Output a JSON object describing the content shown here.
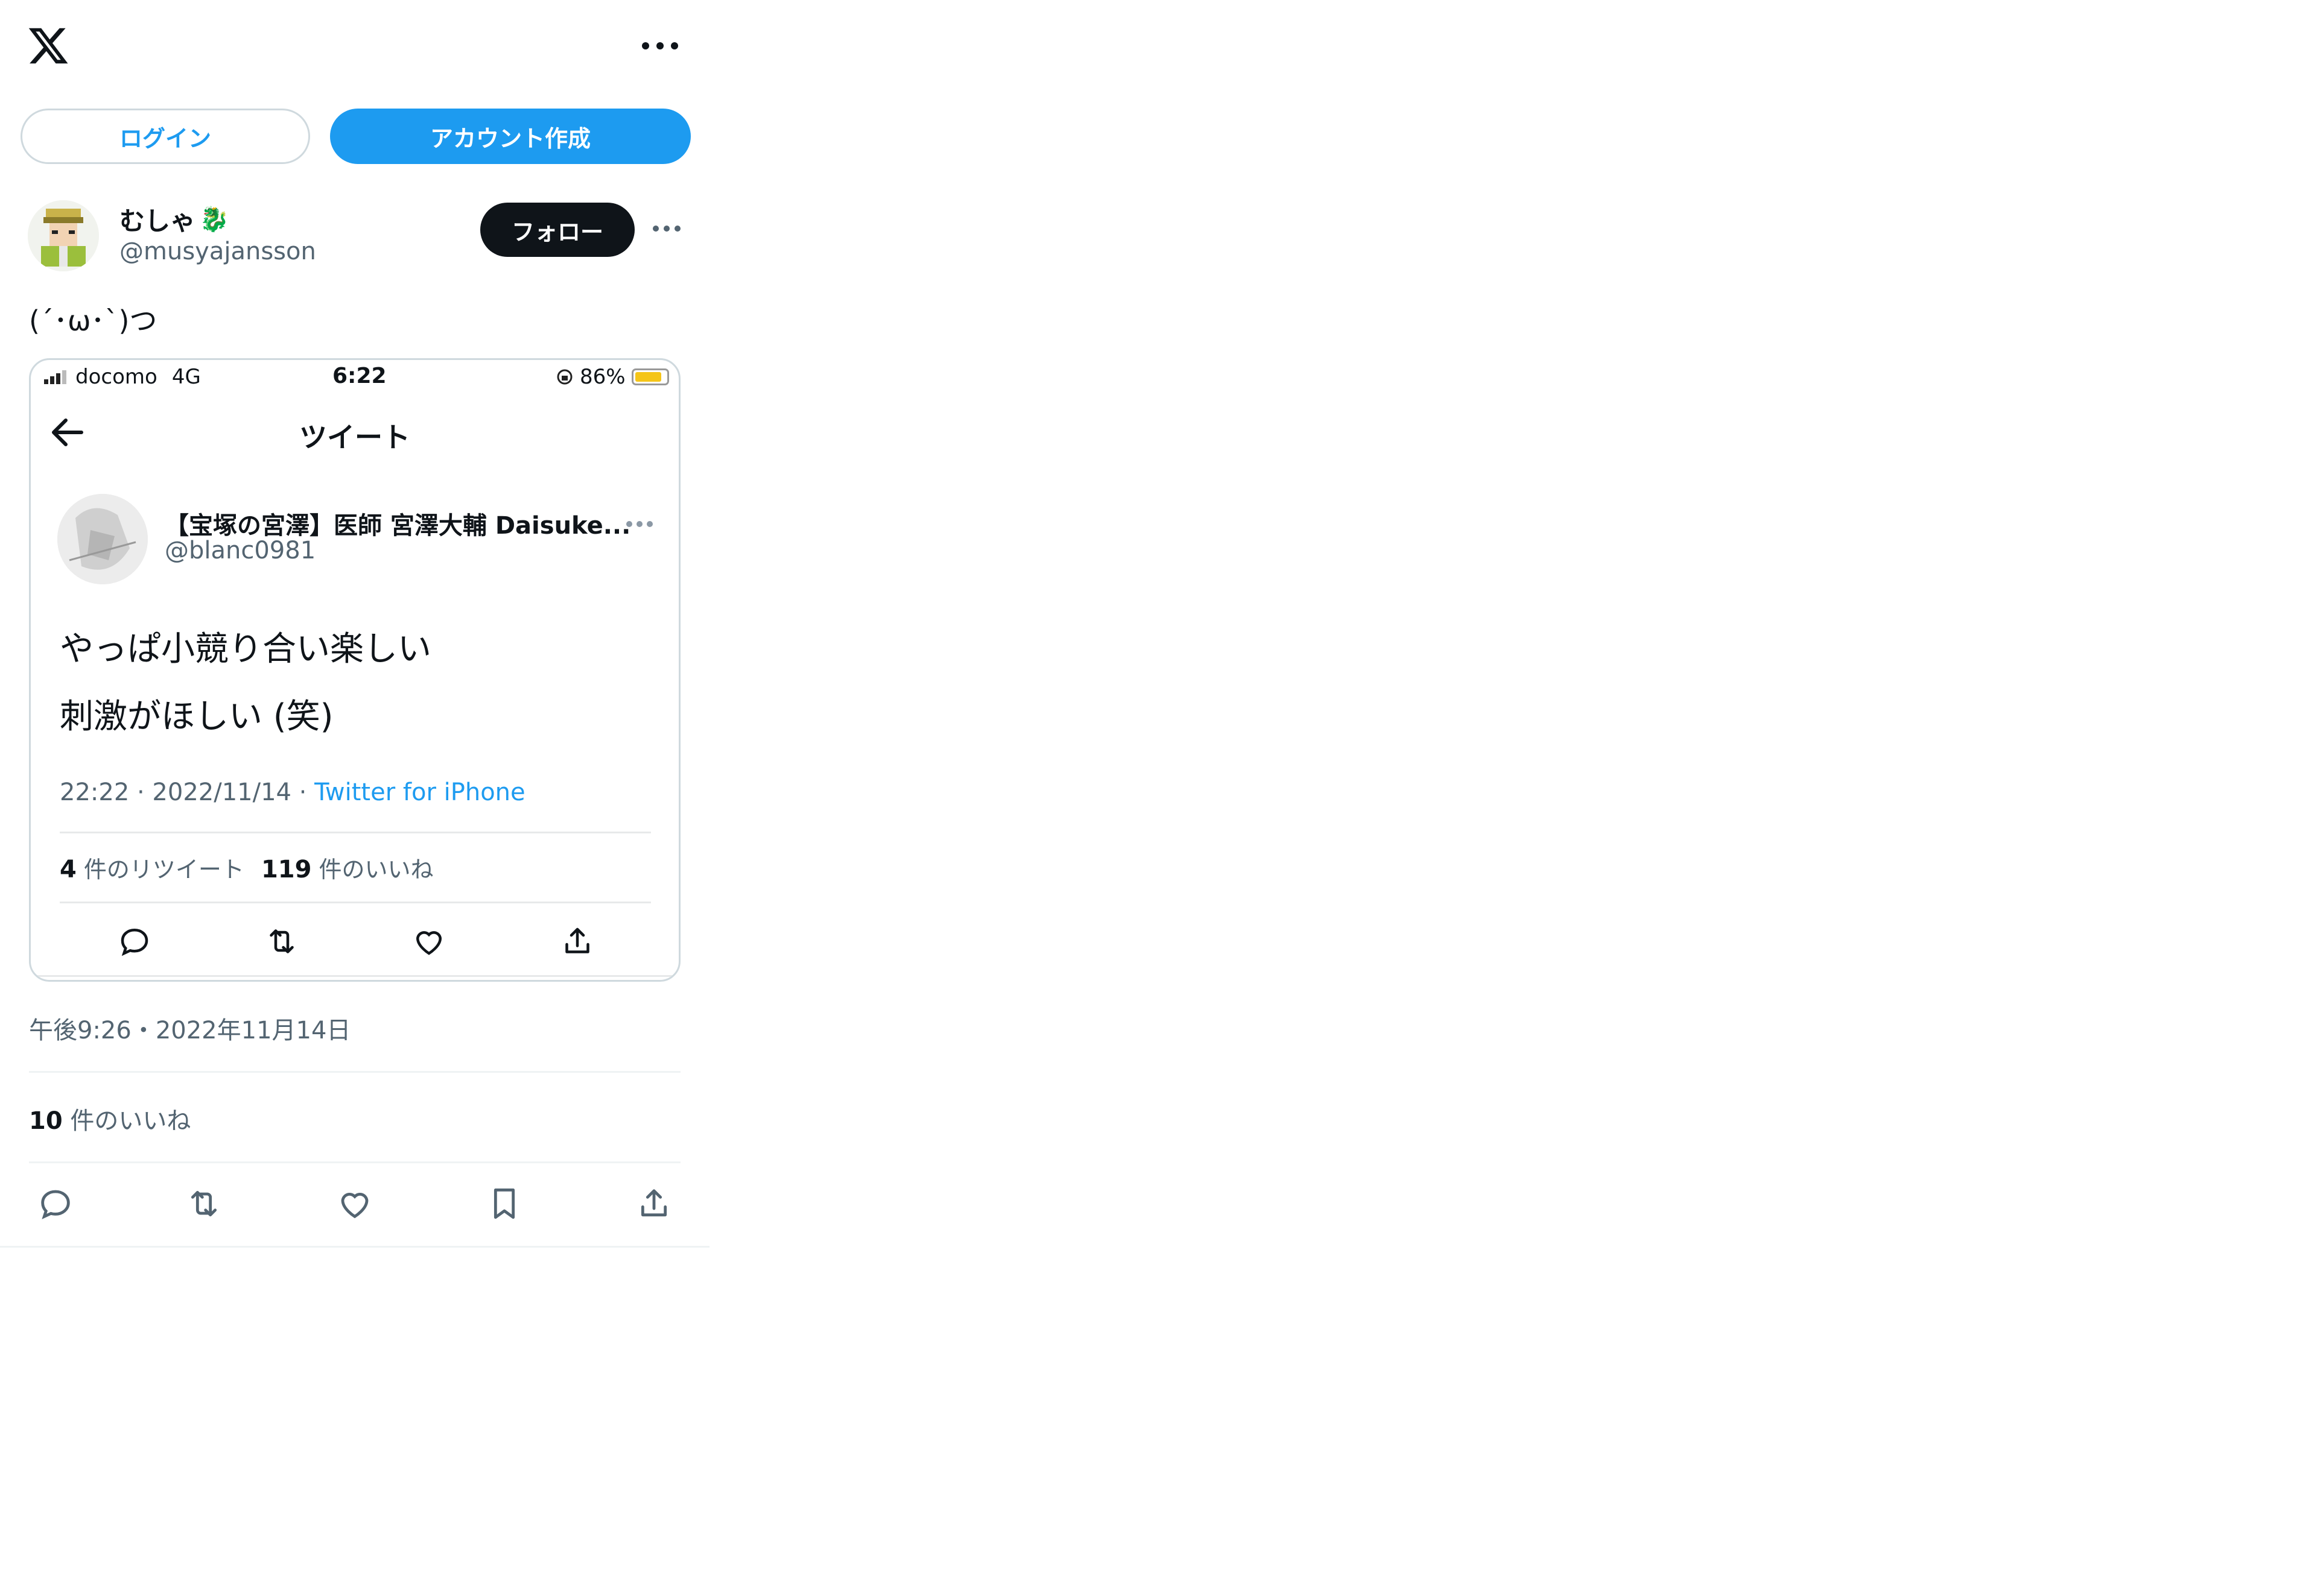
{
  "header": {
    "logo_icon": "x-logo-icon",
    "more_icon": "more-horizontal-icon"
  },
  "auth": {
    "login_label": "ログイン",
    "signup_label": "アカウント作成"
  },
  "author": {
    "name": "むしゃ",
    "emoji": "🐉",
    "handle": "@musyajansson",
    "follow_label": "フォロー"
  },
  "tweet": {
    "text": "(´･ω･`)つ",
    "posted_time": "午後9:26・2022年11月14日",
    "like_count": "10",
    "like_label": " 件のいいね"
  },
  "quoted_screenshot": {
    "status_bar": {
      "carrier": "docomo",
      "network": "4G",
      "time": "6:22",
      "battery": "86%",
      "battery_level": 0.86
    },
    "nav_title": "ツイート",
    "author_name": "【宝塚の宮澤】医師 宮澤大輔 Daisuke...",
    "author_handle": "@blanc0981",
    "text_line1": "やっぱ小競り合い楽しい",
    "text_line2": "刺激がほしい (笑)",
    "meta_time": "22:22 · 2022/11/14 · ",
    "meta_source": "Twitter for iPhone",
    "retweet_count": "4",
    "retweet_label": " 件のリツイート",
    "like_count": "119",
    "like_label": " 件のいいね"
  },
  "colors": {
    "accent": "#1d9bf0",
    "text": "#0f1419",
    "secondary": "#536471",
    "border": "#cfd9de"
  }
}
